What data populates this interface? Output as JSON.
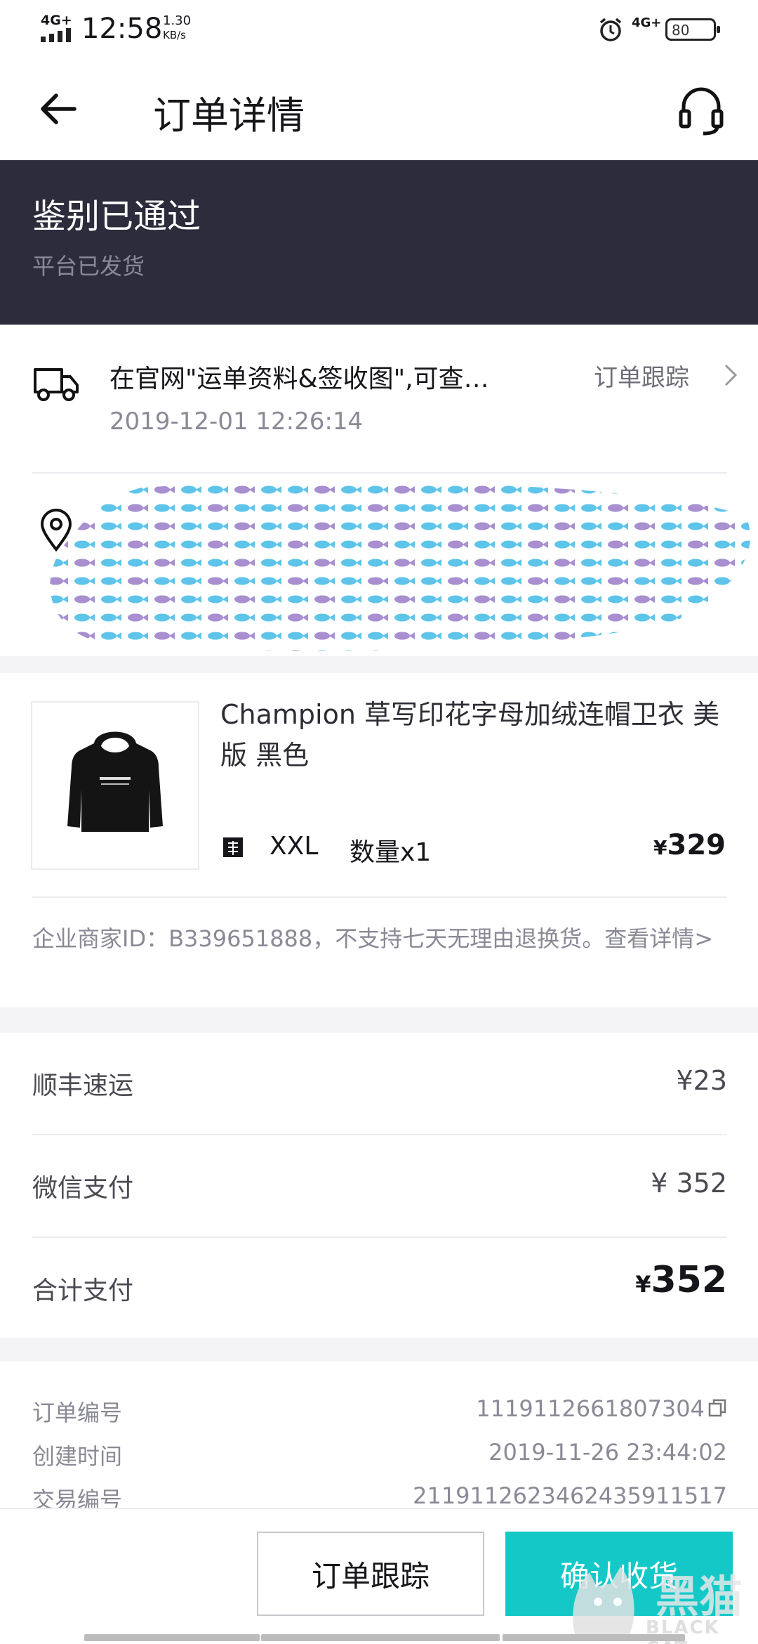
{
  "status_bar": {
    "network": "4G+",
    "time": "12:58",
    "speed_value": "1.30",
    "speed_unit": "KB/s",
    "network2": "4G+",
    "battery": "80"
  },
  "header": {
    "title": "订单详情",
    "back_icon": "arrow-left-icon",
    "service_icon": "headset-icon"
  },
  "banner": {
    "title": "鉴别已通过",
    "subtitle": "平台已发货"
  },
  "logistics": {
    "latest": "在官网\"运单资料&签收图\",可查…",
    "time": "2019-12-01 12:26:14",
    "track_link": "订单跟踪",
    "address_redacted": true
  },
  "product": {
    "name": "Champion 草写印花字母加绒连帽卫衣 美版 黑色",
    "size": "XXL",
    "quantity": "数量x1",
    "currency": "¥",
    "price": "329",
    "merchant_note": "企业商家ID：B339651888，不支持七天无理由退换货。查看详情>"
  },
  "payment": {
    "shipping_label": "顺丰速运",
    "shipping_value": "¥23",
    "wechat_label": "微信支付",
    "wechat_value": "¥ 352",
    "total_label": "合计支付",
    "total_currency": "¥",
    "total_value": "352"
  },
  "order_info": {
    "rows": [
      {
        "label": "订单编号",
        "value": "1119112661807304"
      },
      {
        "label": "创建时间",
        "value": "2019-11-26 23:44:02"
      },
      {
        "label": "交易编号",
        "value": "2119112623462435911517"
      }
    ]
  },
  "bottom": {
    "track_button": "订单跟踪",
    "confirm_button": "确认收货"
  },
  "watermark": {
    "text": "黑猫",
    "sub": "BLACK CAT"
  },
  "colors": {
    "banner_bg": "#2c2c3c",
    "accent": "#14c8c8"
  }
}
